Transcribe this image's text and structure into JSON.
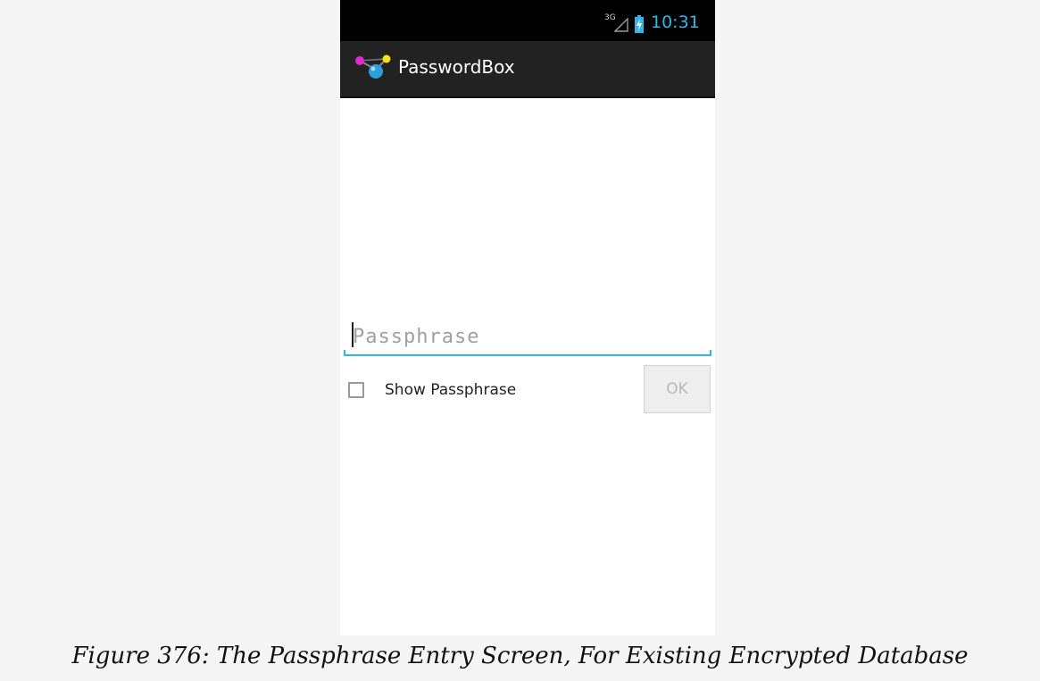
{
  "status_bar": {
    "network": "3G",
    "signal_icon": "signal-icon",
    "battery_icon": "battery-charging-icon",
    "time": "10:31",
    "time_color": "#33b5e5"
  },
  "action_bar": {
    "app_icon": "molecule-app-icon",
    "title": "PasswordBox"
  },
  "form": {
    "passphrase_placeholder": "Passphrase",
    "passphrase_value": "",
    "show_passphrase_label": "Show Passphrase",
    "show_passphrase_checked": false,
    "ok_label": "OK",
    "ok_enabled": false,
    "accent_color": "#33b5e5"
  },
  "caption": "Figure 376: The Passphrase Entry Screen, For Existing Encrypted Database"
}
